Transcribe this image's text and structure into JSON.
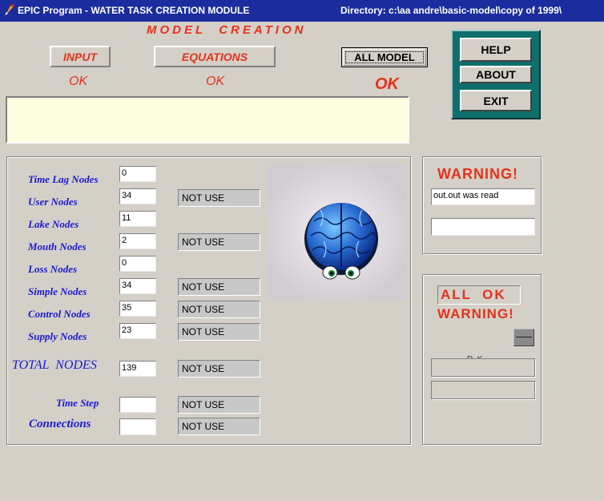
{
  "window": {
    "title": "EPIC Program - WATER TASK CREATION MODULE",
    "directory": "Directory: c:\\aa andre\\basic-model\\copy of 1999\\"
  },
  "header": {
    "model_creation": "MODEL  CREATION",
    "input_label": "INPUT",
    "equations_label": "EQUATIONS",
    "all_model_label": "ALL MODEL",
    "input_status": "OK",
    "equations_status": "OK",
    "all_model_status": "OK"
  },
  "side_menu": {
    "help": "HELP",
    "about": "ABOUT",
    "exit": "EXIT"
  },
  "message_box": "",
  "nodes": [
    {
      "label": "Time Lag Nodes",
      "value": "0",
      "status": ""
    },
    {
      "label": "User Nodes",
      "value": "34",
      "status": "NOT USE"
    },
    {
      "label": "Lake Nodes",
      "value": "11",
      "status": ""
    },
    {
      "label": "Mouth Nodes",
      "value": "2",
      "status": "NOT USE"
    },
    {
      "label": "Loss Nodes",
      "value": "0",
      "status": ""
    },
    {
      "label": "Simple Nodes",
      "value": "34",
      "status": "NOT USE"
    },
    {
      "label": "Control Nodes",
      "value": "35",
      "status": "NOT USE"
    },
    {
      "label": "Supply Nodes",
      "value": "23",
      "status": "NOT USE"
    }
  ],
  "total": {
    "label": "TOTAL  NODES",
    "value": "139",
    "status": "NOT USE"
  },
  "time_step": {
    "label": "Time Step",
    "value": "",
    "status": "NOT USE"
  },
  "connections": {
    "label": "Connections",
    "value": "",
    "status": "NOT USE"
  },
  "warning_panel": {
    "title": "WARNING!",
    "field1": "out.out  was read",
    "field2": ""
  },
  "status_panel": {
    "all_ok": "ALL  OK",
    "warning": "WARNING!",
    "partial_text": "D  K",
    "field1": "",
    "field2": ""
  },
  "colors": {
    "title_bar": "#1b2d9e",
    "accent_red": "#e8311a",
    "label_blue": "#1a1ad4",
    "menu_teal": "#0e6f6c",
    "message_bg": "#fdfde0"
  }
}
